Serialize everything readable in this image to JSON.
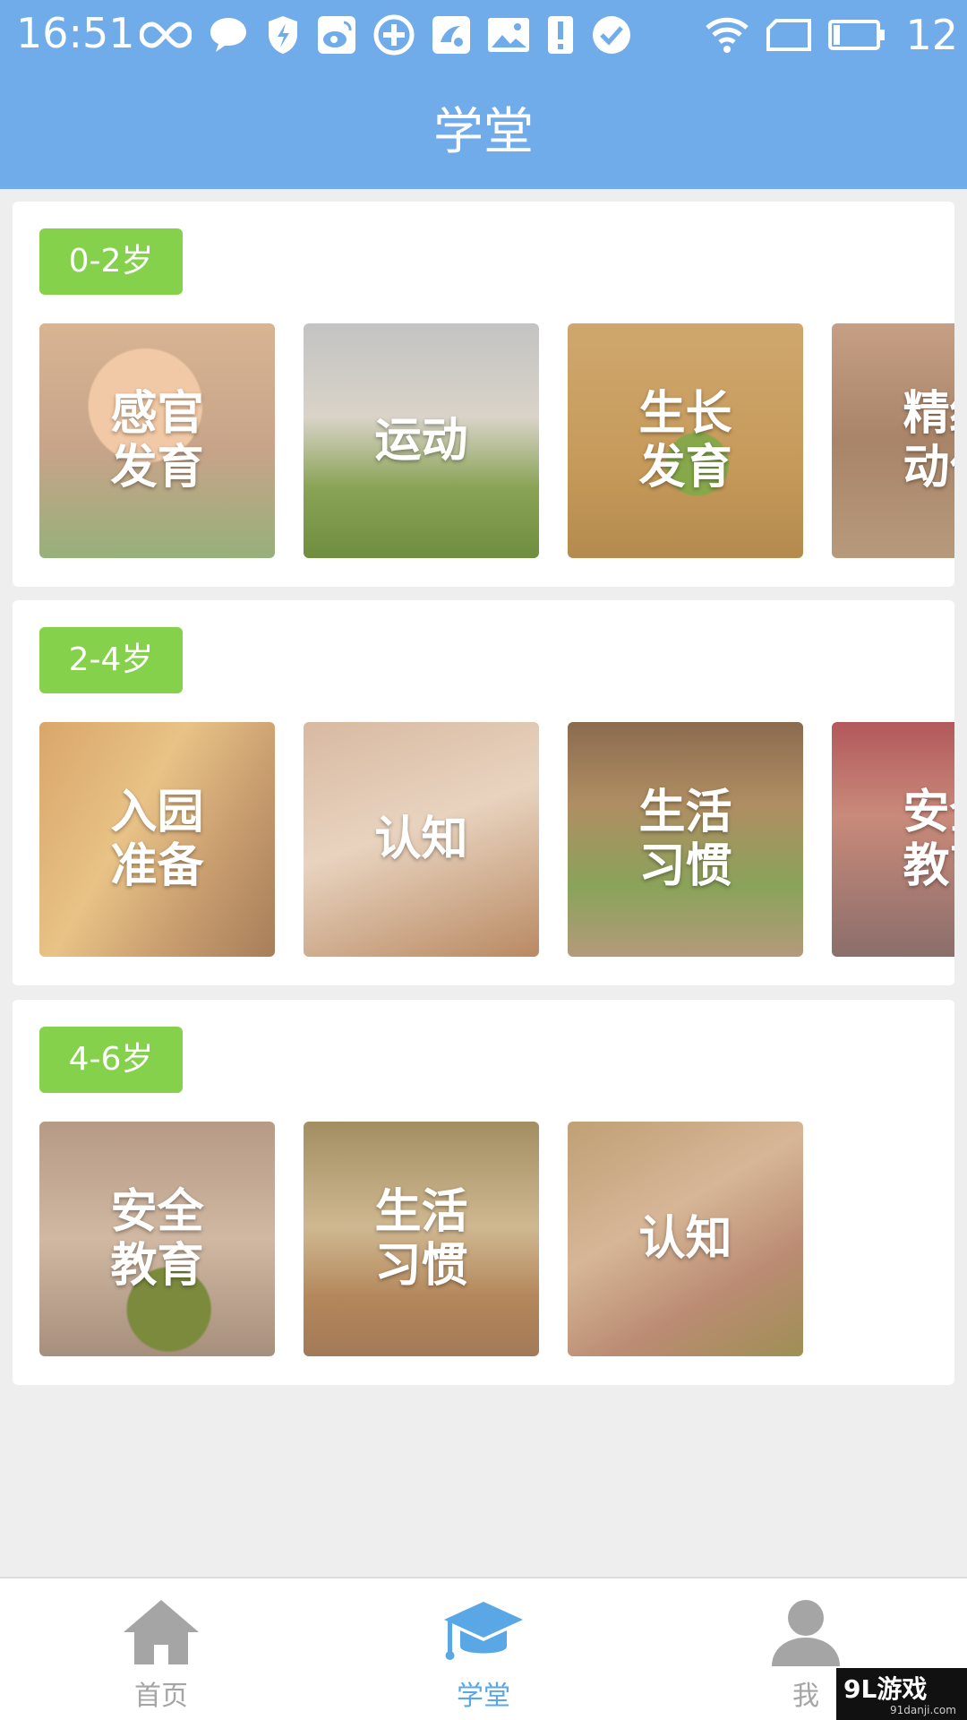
{
  "status_bar": {
    "time": "16:51",
    "battery_level_text": "12",
    "left_icons": [
      "infinity-icon",
      "chat-bubble-icon",
      "shield-lightning-icon",
      "weibo-icon",
      "sync-plus-icon",
      "uc-browser-icon",
      "image-icon",
      "alert-icon",
      "checkmark-circle-icon"
    ],
    "right_icons": [
      "wifi-icon",
      "sim-card-icon",
      "battery-icon"
    ]
  },
  "header": {
    "title": "学堂"
  },
  "sections": [
    {
      "age_label": "0-2岁",
      "cards": [
        {
          "label": "感官\n发育"
        },
        {
          "label": "运动"
        },
        {
          "label": "生长\n发育"
        },
        {
          "label": "精细\n动作"
        }
      ]
    },
    {
      "age_label": "2-4岁",
      "cards": [
        {
          "label": "入园\n准备"
        },
        {
          "label": "认知"
        },
        {
          "label": "生活\n习惯"
        },
        {
          "label": "安全\n教育"
        }
      ]
    },
    {
      "age_label": "4-6岁",
      "cards": [
        {
          "label": "安全\n教育"
        },
        {
          "label": "生活\n习惯"
        },
        {
          "label": "认知"
        }
      ]
    }
  ],
  "tab_bar": {
    "tabs": [
      {
        "label": "首页",
        "icon": "home-icon",
        "active": false
      },
      {
        "label": "学堂",
        "icon": "graduation-cap-icon",
        "active": true
      },
      {
        "label": "我",
        "icon": "person-icon",
        "active": false
      }
    ]
  },
  "colors": {
    "header_bg": "#70abea",
    "badge_bg": "#86d14c",
    "active_tab": "#5aa7e6",
    "inactive_tab": "#a5a5a5",
    "page_bg": "#eeeeee"
  },
  "watermark": {
    "main": "9L游戏",
    "sub": "91danji.com"
  }
}
